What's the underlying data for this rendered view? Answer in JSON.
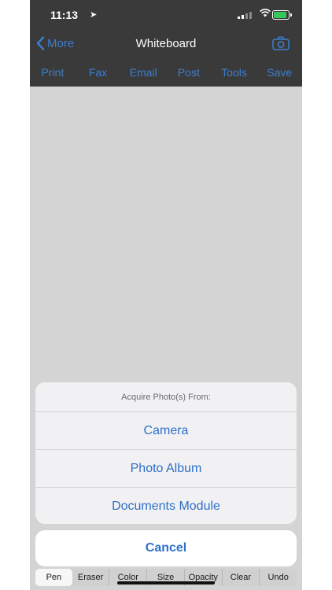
{
  "status": {
    "time": "11:13",
    "battery_color": "#35c759"
  },
  "nav": {
    "back_label": "More",
    "title": "Whiteboard",
    "camera_icon": "camera-icon"
  },
  "toolbar": {
    "items": [
      "Print",
      "Fax",
      "Email",
      "Post",
      "Tools",
      "Save"
    ]
  },
  "action_sheet": {
    "title": "Acquire Photo(s) From:",
    "options": [
      "Camera",
      "Photo Album",
      "Documents Module"
    ],
    "cancel": "Cancel"
  },
  "tools": {
    "items": [
      "Pen",
      "Eraser",
      "Color",
      "Size",
      "Opacity",
      "Clear",
      "Undo"
    ],
    "active": "Pen"
  },
  "colors": {
    "accent": "#3b7ed0",
    "bar_bg": "#3a3a3a",
    "canvas": "#d4d4d4"
  }
}
